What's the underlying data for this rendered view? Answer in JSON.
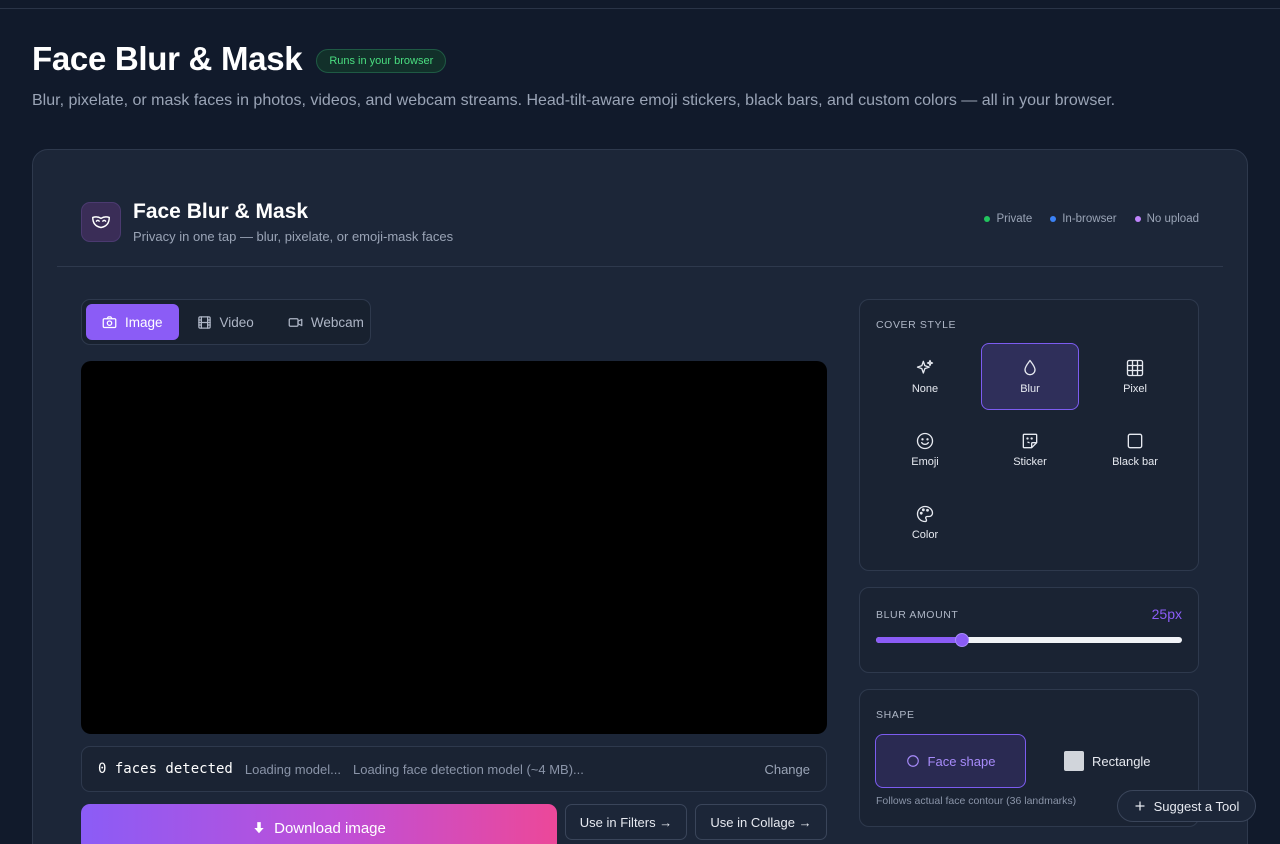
{
  "hero": {
    "title": "Face Blur & Mask",
    "badge": "Runs in your browser",
    "subtitle": "Blur, pixelate, or mask faces in photos, videos, and webcam streams. Head-tilt-aware emoji stickers, black bars, and custom colors — all in your browser."
  },
  "app": {
    "title": "Face Blur & Mask",
    "subtitle": "Privacy in one tap — blur, pixelate, or emoji-mask faces",
    "pills": [
      {
        "label": "Private",
        "color": "#22c55e"
      },
      {
        "label": "In-browser",
        "color": "#3b82f6"
      },
      {
        "label": "No upload",
        "color": "#c084fc"
      }
    ]
  },
  "tabs": [
    {
      "label": "Image",
      "icon": "camera-icon",
      "active": true
    },
    {
      "label": "Video",
      "icon": "film-icon",
      "active": false
    },
    {
      "label": "Webcam",
      "icon": "video-camera-icon",
      "active": false
    }
  ],
  "status": {
    "faces": "0 faces detected",
    "state": "Loading model...",
    "detail": "Loading face detection model (~4 MB)...",
    "change": "Change"
  },
  "actions": {
    "download": "Download image",
    "filters": "Use in Filters →",
    "collage": "Use in Collage →"
  },
  "cover_style": {
    "label": "Cover style",
    "options": [
      {
        "label": "None",
        "icon": "sparkles-icon",
        "active": false
      },
      {
        "label": "Blur",
        "icon": "droplet-icon",
        "active": true
      },
      {
        "label": "Pixel",
        "icon": "grid-icon",
        "active": false
      },
      {
        "label": "Emoji",
        "icon": "smile-icon",
        "active": false
      },
      {
        "label": "Sticker",
        "icon": "sticker-icon",
        "active": false
      },
      {
        "label": "Black bar",
        "icon": "square-icon",
        "active": false
      },
      {
        "label": "Color",
        "icon": "palette-icon",
        "active": false
      }
    ]
  },
  "blur_amount": {
    "label": "Blur amount",
    "value": "25px",
    "fraction": 0.28
  },
  "shape": {
    "label": "Shape",
    "face_shape": "Face shape",
    "rectangle": "Rectangle",
    "hint": "Follows actual face contour (36 landmarks)"
  },
  "suggest": "Suggest a Tool",
  "colors": {
    "accent": "#8b5cf6",
    "background": "#111a2b",
    "card": "#1c2638"
  }
}
